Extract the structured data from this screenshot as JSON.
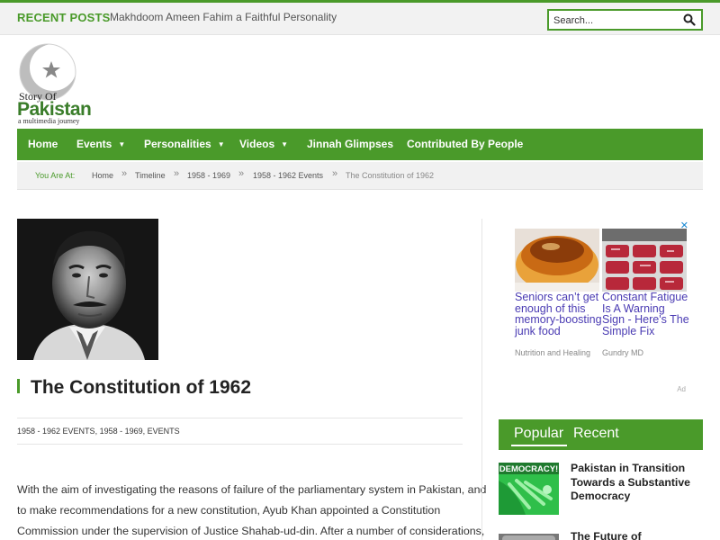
{
  "topbar": {
    "recent_label": "RECENT POSTS",
    "recent_item": "Makhdoom Ameen Fahim a Faithful Personality",
    "search_placeholder": "Search..."
  },
  "logo": {
    "story": "Story Of",
    "pakistan": "Pakistan",
    "tagline": "a multimedia journey"
  },
  "nav": {
    "items": [
      {
        "label": "Home",
        "dropdown": false
      },
      {
        "label": "Events",
        "dropdown": true
      },
      {
        "label": "Personalities",
        "dropdown": true
      },
      {
        "label": "Videos",
        "dropdown": true
      },
      {
        "label": "Jinnah Glimpses",
        "dropdown": false
      },
      {
        "label": "Contributed By People",
        "dropdown": false
      }
    ]
  },
  "breadcrumb": {
    "you_are_at": "You Are At:",
    "separator": "»",
    "items": [
      "Home",
      "Timeline",
      "1958 - 1969",
      "1958 - 1962 Events"
    ],
    "current": "The Constitution of 1962"
  },
  "article": {
    "title": "The Constitution of 1962",
    "categories": [
      "1958 - 1962 EVENTS",
      "1958 - 1969",
      "EVENTS"
    ],
    "category_separator": ", ",
    "lines": [
      "With the aim of investigating the reasons of failure of the parliamentary system in Pakistan, and",
      "to make recommendations for a new constitution, Ayub Khan appointed a Constitution",
      "Commission under the supervision of Justice Shahab-ud-din. After a number of considerations,"
    ]
  },
  "ad": {
    "close_glyph": "✕",
    "items": [
      {
        "headline": "Seniors can’t get enough of this memory-boosting junk food",
        "source": "Nutrition and Healing"
      },
      {
        "headline": "Constant Fatigue Is A Warning Sign - Here's The Simple Fix",
        "source": "Gundry MD"
      }
    ],
    "label": "Ad"
  },
  "sidebar": {
    "tabs": [
      "Popular",
      "Recent"
    ],
    "active_tab": "Popular",
    "posts": [
      {
        "title": "Pakistan in Transition Towards a Substantive Democracy",
        "thumb_text": "DEMOCRACY!"
      },
      {
        "title": "The Future of",
        "thumb_text": ""
      }
    ]
  },
  "colors": {
    "accent": "#4a9a2a",
    "link": "#4a3bb3",
    "text": "#333333"
  },
  "icons": {
    "search": "search-icon",
    "close": "close-icon",
    "chevron": "chevron-down-icon"
  }
}
